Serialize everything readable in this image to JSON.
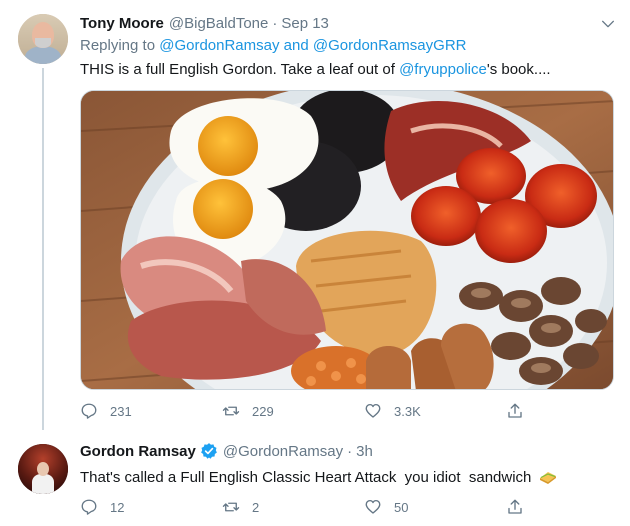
{
  "tweets": [
    {
      "name": "Tony Moore",
      "handle": "@BigBaldTone",
      "time": "Sep 13",
      "replying_to_prefix": "Replying to",
      "replying_to_users": [
        "@GordonRamsay",
        "@GordonRamsayGRR"
      ],
      "replying_to_joiner": "and",
      "text_before_link": "THIS is a full English Gordon. Take a leaf out of",
      "text_link": "@fryuppolice",
      "text_after_link": "'s book....",
      "stats": {
        "replies": "231",
        "retweets": "229",
        "likes": "3.3K"
      }
    },
    {
      "name": "Gordon Ramsay",
      "handle": "@GordonRamsay",
      "time": "3h",
      "verified": true,
      "text": "That's called a Full English Classic Heart Attack  you idiot  sandwich",
      "stats": {
        "replies": "12",
        "retweets": "2",
        "likes": "50"
      }
    }
  ],
  "icons": {
    "reply": "reply-icon",
    "retweet": "retweet-icon",
    "like": "heart-icon",
    "share": "share-icon",
    "more": "chevron-down-icon",
    "verified": "verified-badge-icon",
    "sandwich": "sandwich-emoji-icon"
  },
  "colors": {
    "link": "#1b95e0",
    "secondary_text": "#657786",
    "verified": "#1da1f2",
    "thread_line": "#ccd6dd"
  }
}
